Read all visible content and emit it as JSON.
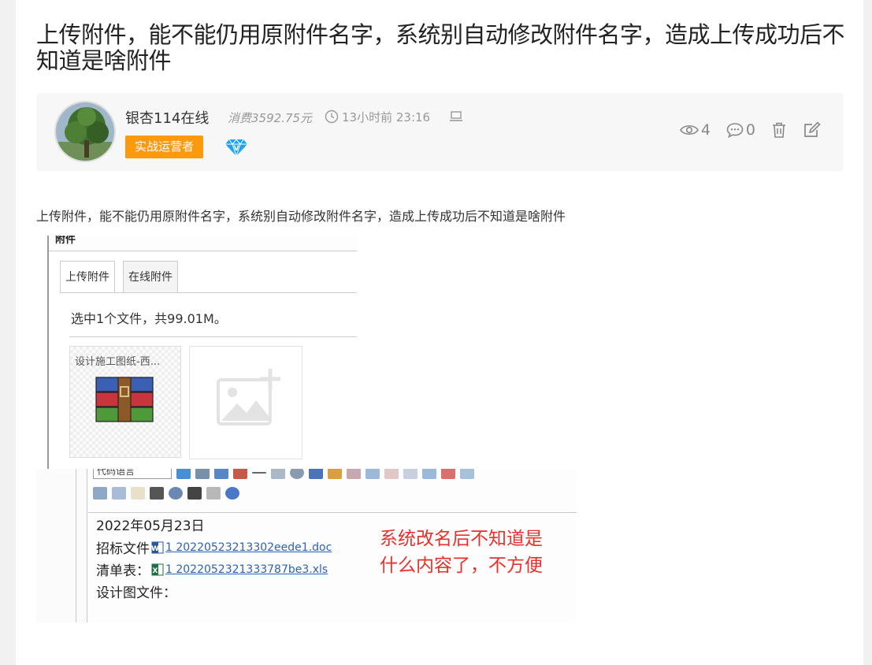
{
  "post": {
    "title": "上传附件，能不能仍用原附件名字，系统别自动修改附件名字，造成上传成功后不知道是啥附件",
    "content": "上传附件，能不能仍用原附件名字，系统别自动修改附件名字，造成上传成功后不知道是啥附件"
  },
  "author": {
    "name": "银杏114在线",
    "consume": "消费3592.75元",
    "time": "13小时前 23:16",
    "role_badge": "实战运营者",
    "badge_color": "#fc9a0e"
  },
  "stats": {
    "views": "4",
    "comments": "0",
    "icons": [
      "eye-icon",
      "comment-icon",
      "trash-icon",
      "edit-icon"
    ]
  },
  "screenshot1": {
    "header": "附件",
    "tabs": [
      "上传附件",
      "在线附件"
    ],
    "selection_text": "选中1个文件，共99.01M。",
    "file_name": "设计施工图纸-西..."
  },
  "screenshot2": {
    "code_select": "代码语言",
    "date_line": "2022年05月23日",
    "bid_label": "招标文件",
    "bid_link": "1 20220523213302eede1.doc",
    "list_label": "清单表：",
    "list_link": "1 2022052321333787be3.xls",
    "design_label": "设计图文件：",
    "annotation_line1": "系统改名后不知道是",
    "annotation_line2": "什么内容了，不方便",
    "annotation_color": "#e8302c"
  }
}
